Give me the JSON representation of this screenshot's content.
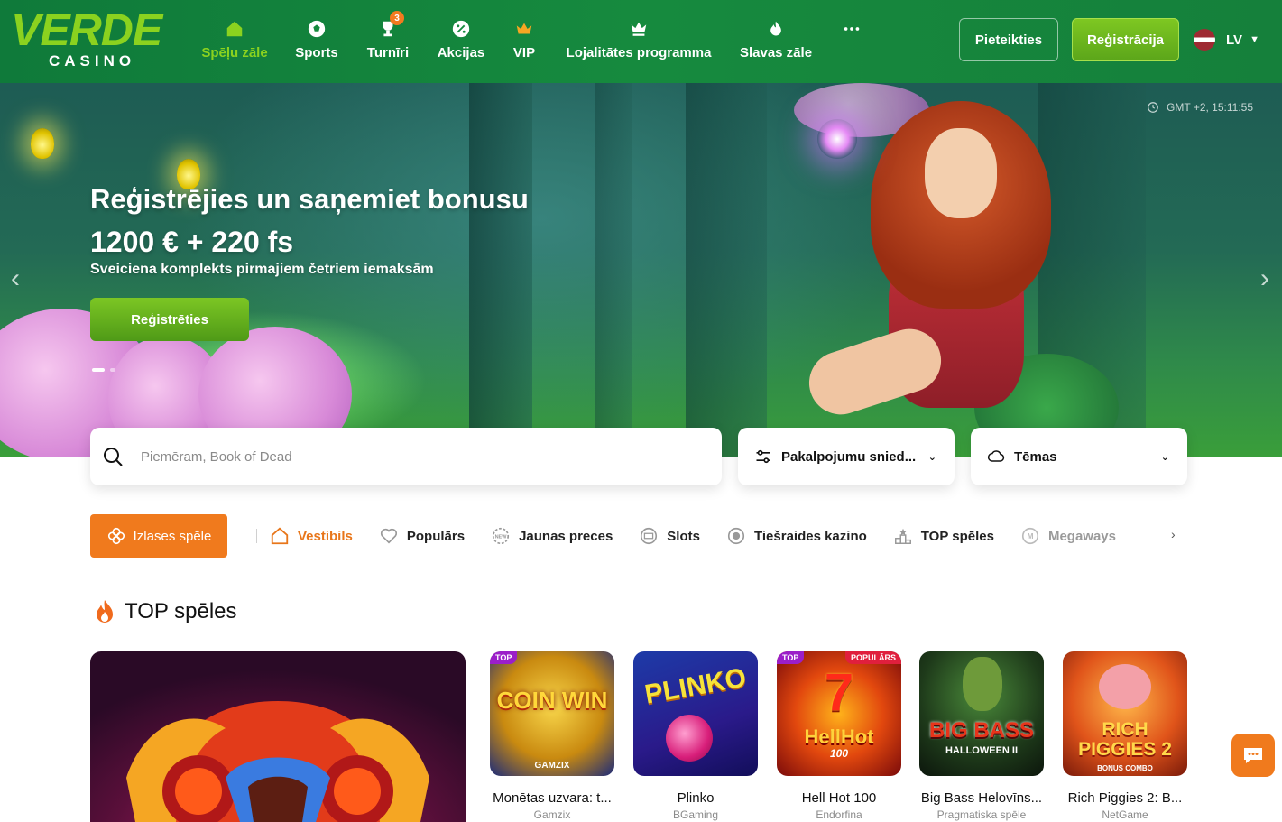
{
  "header": {
    "logo_main": "VERDE",
    "logo_sub": "CASINO",
    "nav": [
      {
        "label": "Spēļu zāle",
        "icon": "home-icon",
        "active": true
      },
      {
        "label": "Sports",
        "icon": "soccer-ball-icon"
      },
      {
        "label": "Turnīri",
        "icon": "trophy-icon",
        "badge": "3"
      },
      {
        "label": "Akcijas",
        "icon": "percent-badge-icon"
      },
      {
        "label": "VIP",
        "icon": "crown-icon"
      },
      {
        "label": "Lojalitātes programma",
        "icon": "royal-crown-icon"
      },
      {
        "label": "Slavas zāle",
        "icon": "flame-icon"
      }
    ],
    "more_icon": "more-dots-icon",
    "login_label": "Pieteikties",
    "register_label": "Reģistrācija",
    "language": "LV",
    "colors": {
      "header_bg": "#168a3e",
      "accent_green": "#8bd21f",
      "accent_orange": "#f07a1d"
    }
  },
  "hero": {
    "clock": "GMT +2, 15:11:55",
    "title": "Reģistrējies un saņemiet bonusu",
    "amount": "1200 € + 220 fs",
    "subtitle": "Sveiciena komplekts pirmajiem četriem iemaksām",
    "cta_label": "Reģistrēties",
    "slides_total": 2,
    "slide_active": 1
  },
  "filters": {
    "search_placeholder": "Piemēram, Book of Dead",
    "providers_label": "Pakalpojumu snied...",
    "themes_label": "Tēmas"
  },
  "categories": {
    "favorites_label": "Izlases spēle",
    "items": [
      {
        "label": "Vestibils",
        "icon": "lobby-icon",
        "active": true
      },
      {
        "label": "Populārs",
        "icon": "heart-icon"
      },
      {
        "label": "Jaunas preces",
        "icon": "new-badge-icon"
      },
      {
        "label": "Slots",
        "icon": "slot-icon"
      },
      {
        "label": "Tiešraides kazino",
        "icon": "live-dot-icon"
      },
      {
        "label": "TOP spēles",
        "icon": "podium-icon"
      },
      {
        "label": "Megaways",
        "icon": "megaways-icon",
        "faded": true
      }
    ]
  },
  "section": {
    "title": "TOP spēles",
    "games": [
      {
        "name": "Monētas uzvara: t...",
        "provider": "Gamzix",
        "thumb_text": "COIN WIN",
        "thumb_caption": "GAMZIX",
        "tags": [
          "TOP"
        ]
      },
      {
        "name": "Plinko",
        "provider": "BGaming",
        "thumb_text": "PLINKO",
        "tags": []
      },
      {
        "name": "Hell Hot 100",
        "provider": "Endorfina",
        "thumb_text": "HellHot",
        "thumb_caption": "100",
        "tags": [
          "TOP",
          "POPULĀRS"
        ]
      },
      {
        "name": "Big Bass Helovīns...",
        "provider": "Pragmatiska spēle",
        "thumb_text": "BIG BASS",
        "thumb_caption": "HALLOWEEN II",
        "tags": []
      },
      {
        "name": "Rich Piggies 2: B...",
        "provider": "NetGame",
        "thumb_text": "RICH PIGGIES 2",
        "thumb_caption": "BONUS COMBO",
        "tags": []
      }
    ]
  }
}
